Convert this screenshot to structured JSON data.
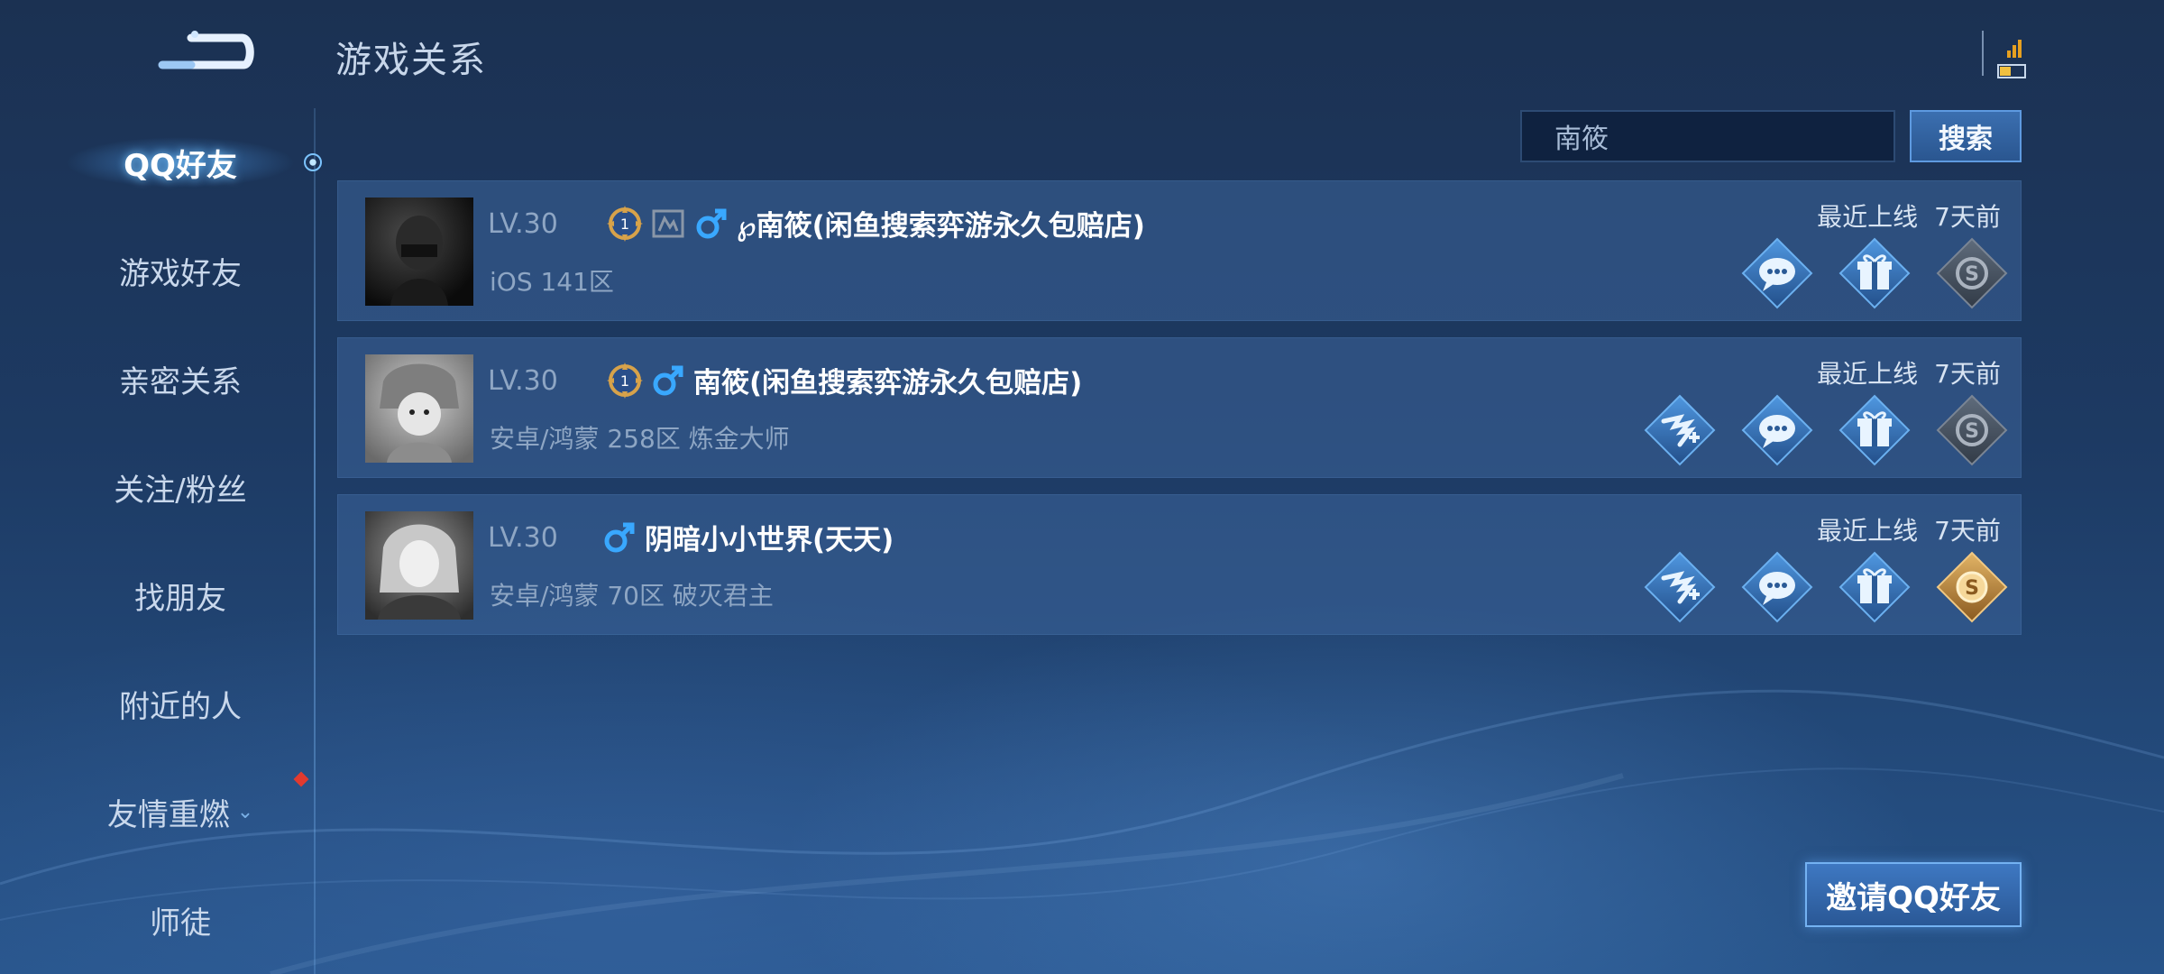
{
  "header": {
    "title": "游戏关系",
    "back_icon": "back-arrow-icon",
    "status_icon": "signal-battery-icon"
  },
  "sidebar": {
    "items": [
      {
        "label": "QQ好友",
        "active": true
      },
      {
        "label": "游戏好友"
      },
      {
        "label": "亲密关系"
      },
      {
        "label": "关注/粉丝"
      },
      {
        "label": "找朋友"
      },
      {
        "label": "附近的人"
      },
      {
        "label": "友情重燃",
        "chevron": "⌄",
        "badge": "red-diamond"
      },
      {
        "label": "师徒"
      }
    ]
  },
  "search": {
    "value": "南筱",
    "button_label": "搜索"
  },
  "friends": [
    {
      "level": "LV.30",
      "name": "℘南筱(闲鱼搜索弈游永久包赔店)",
      "server": "iOS 141区",
      "last_online_label": "最近上线",
      "last_online_value": "7天前",
      "icons": [
        "rank-badge-icon",
        "frame-icon",
        "male-icon"
      ],
      "actions": [
        "chat-icon",
        "gift-icon",
        "coin-icon"
      ]
    },
    {
      "level": "LV.30",
      "name": "南筱(闲鱼搜索弈游永久包赔店)",
      "server": "安卓/鸿蒙 258区 炼金大师",
      "last_online_label": "最近上线",
      "last_online_value": "7天前",
      "icons": [
        "rank-badge-icon",
        "male-icon"
      ],
      "actions": [
        "add-friend-icon",
        "chat-icon",
        "gift-icon",
        "coin-icon"
      ]
    },
    {
      "level": "LV.30",
      "name": "阴暗小小世界(天天)",
      "server": "安卓/鸿蒙 70区 破灭君主",
      "last_online_label": "最近上线",
      "last_online_value": "7天前",
      "icons": [
        "male-icon"
      ],
      "actions": [
        "add-friend-icon",
        "chat-icon",
        "gift-icon",
        "coin-gold-icon"
      ]
    }
  ],
  "footer": {
    "invite_label": "邀请QQ好友"
  },
  "colors": {
    "accent": "#3e78c2",
    "male": "#39a8ff",
    "gold": "#d7a24a"
  }
}
